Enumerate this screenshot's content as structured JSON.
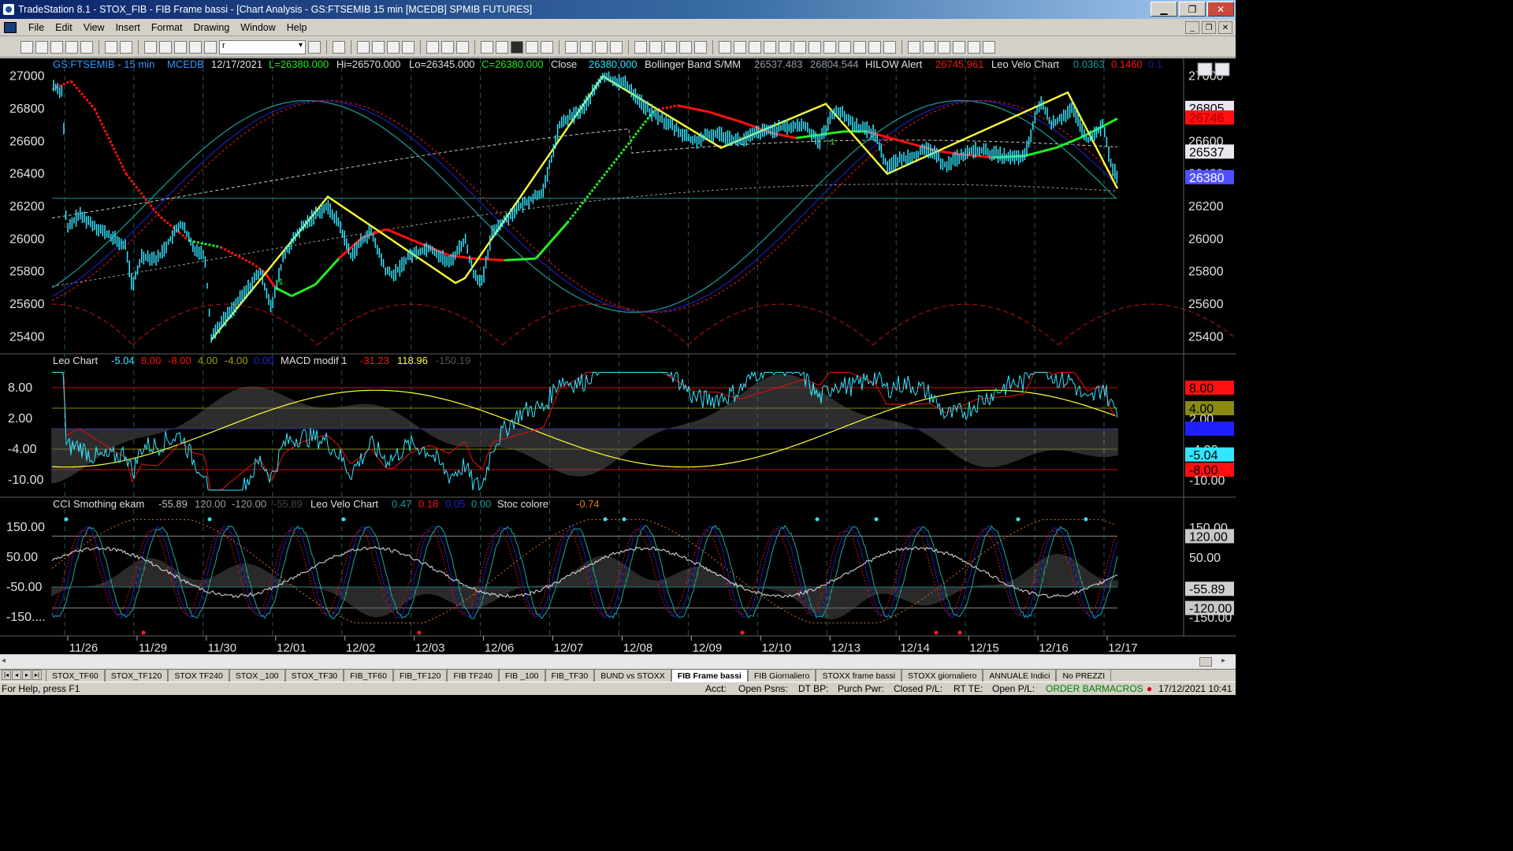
{
  "window": {
    "title": "TradeStation 8.1 - STOX_FIB - FIB Frame bassi - [Chart Analysis - GS:FTSEMIB  15 min  [MCEDB] SPMIB FUTURES]",
    "controls": {
      "minimize": "▁",
      "maximize": "❐",
      "close": "✕"
    }
  },
  "menu": {
    "items": [
      "File",
      "Edit",
      "View",
      "Insert",
      "Format",
      "Drawing",
      "Window",
      "Help"
    ],
    "mdi_controls": [
      "_",
      "❐",
      "✕"
    ]
  },
  "toolbar": {
    "symbol_value": "r"
  },
  "chart": {
    "header": {
      "symbol": "GS:FTSEMIB - 15 min",
      "source": "MCEDB",
      "date": "12/17/2021",
      "last": "L=26380.000",
      "high": "Hi=26570.000",
      "low": "Lo=26345.000",
      "close_val": "C=26380.000",
      "close_label": "Close",
      "close_num": "26380.000",
      "bb_label": "Bollinger Band S/MM",
      "bb_v1": "26537.483",
      "bb_v2": "26804.544",
      "hilow_label": "HILOW Alert",
      "hilow_v": "26745.961",
      "leo_label": "Leo Velo Chart",
      "leo_v1": "0.0363",
      "leo_v2": "0.1460",
      "leo_v3": "0.1"
    },
    "price_axis": [
      "27000",
      "26800",
      "26600",
      "26400",
      "26200",
      "26000",
      "25800",
      "25600",
      "25400"
    ],
    "price_boxes": {
      "b1": "26805",
      "b2": "26746",
      "b3": "26537",
      "b4": "26380"
    },
    "x_labels": [
      "11/26",
      "11/29",
      "11/30",
      "12/01",
      "12/02",
      "12/03",
      "12/06",
      "12/07",
      "12/08",
      "12/09",
      "12/10",
      "12/13",
      "12/14",
      "12/15",
      "12/16",
      "12/17"
    ],
    "panel2": {
      "name": "Leo Chart",
      "v1": "-5.04",
      "v2": "8.00",
      "v3": "-8.00",
      "v4": "4.00",
      "v5": "-4.00",
      "v6": "0.00",
      "macd_label": "MACD modif 1",
      "m1": "-31.23",
      "m2": "118.96",
      "m3": "-150.19",
      "axis": [
        "8.00",
        "2.00",
        "-4.00",
        "-10.00"
      ],
      "boxes": {
        "b1": "8.00",
        "b2": "4.00",
        "b3": "2.00",
        "b4": "0.00",
        "b5": "-4.00",
        "b6": "-5.04",
        "b7": "-8.00",
        "b8": "-10.00"
      }
    },
    "panel3": {
      "name": "CCI Smothing ekam",
      "v1": "-55.89",
      "v2": "120.00",
      "v3": "-120.00",
      "v4": "-55.89",
      "leo_label": "Leo Velo Chart",
      "l1": "0.47",
      "l2": "0.18",
      "l3": "0.05",
      "l4": "0.00",
      "stoc_label": "Stoc colore",
      "stoc_v": "-0.74",
      "axis": [
        "150.00",
        "50.00",
        "-50.00",
        "-150...."
      ],
      "boxes": {
        "b1": "150.00",
        "b2": "120.00",
        "b3": "50.00",
        "b4": "-55.89",
        "b5": "-120.00",
        "b6": "-150.00"
      }
    },
    "colors": {
      "cyan": "#33e5ff",
      "red": "#ff1010",
      "green": "#22ee22",
      "yellow": "#ffff33",
      "navy": "#1a1aa0",
      "teal": "#1a8a8a",
      "white": "#e0e0e0"
    }
  },
  "tabs": [
    "STOX_TF60",
    "STOX_TF120",
    "STOX TF240",
    "STOX _100",
    "STOX_TF30",
    "FIB_TF60",
    "FIB_TF120",
    "FIB TF240",
    "FIB _100",
    "FIB_TF30",
    "BUND vs STOXX",
    "FIB Frame bassi",
    "FIB Giornaliero",
    "STOXX frame bassi",
    "STOXX giornaliero",
    "ANNUALE Indici",
    "No PREZZI"
  ],
  "active_tab": "FIB Frame bassi",
  "status": {
    "help": "For Help, press F1",
    "acct": "Acct:",
    "open_psns": "Open Psns:",
    "dt_bp": "DT BP:",
    "purch_pwr": "Purch Pwr:",
    "closed_pl": "Closed P/L:",
    "rt_te": "RT TE:",
    "open_pl": "Open P/L:",
    "order_bar": "ORDER BAR",
    "macros": "MACROS",
    "datetime": "17/12/2021 10:41"
  }
}
